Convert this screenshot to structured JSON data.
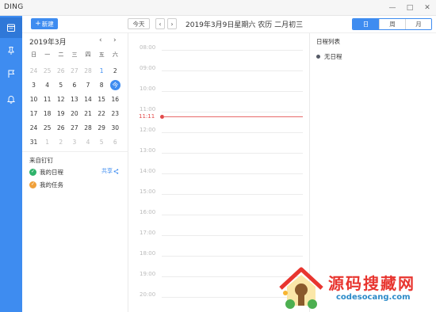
{
  "window": {
    "title": "DING",
    "min": "—",
    "max": "□",
    "close": "✕"
  },
  "rail": {
    "icons": [
      "calendar-icon",
      "pin-icon",
      "flag-icon",
      "bell-icon"
    ],
    "accent": "#3e8cf0"
  },
  "toolbar": {
    "new_label": "新建",
    "new_plus": "+",
    "today_label": "今天",
    "prev": "‹",
    "next": "›",
    "date_title": "2019年3月9日星期六  农历 二月初三",
    "views": [
      "日",
      "周",
      "月"
    ],
    "active_view": "日"
  },
  "mini_calendar": {
    "title": "2019年3月",
    "prev": "‹",
    "next": "›",
    "weekdays": [
      "日",
      "一",
      "二",
      "三",
      "四",
      "五",
      "六"
    ],
    "days": [
      {
        "d": "24",
        "o": true
      },
      {
        "d": "25",
        "o": true
      },
      {
        "d": "26",
        "o": true
      },
      {
        "d": "27",
        "o": true
      },
      {
        "d": "28",
        "o": true
      },
      {
        "d": "1",
        "b": true
      },
      {
        "d": "2"
      },
      {
        "d": "3"
      },
      {
        "d": "4"
      },
      {
        "d": "5"
      },
      {
        "d": "6"
      },
      {
        "d": "7"
      },
      {
        "d": "8"
      },
      {
        "d": "今",
        "sel": true
      },
      {
        "d": "10"
      },
      {
        "d": "11"
      },
      {
        "d": "12"
      },
      {
        "d": "13"
      },
      {
        "d": "14"
      },
      {
        "d": "15"
      },
      {
        "d": "16"
      },
      {
        "d": "17"
      },
      {
        "d": "18"
      },
      {
        "d": "19"
      },
      {
        "d": "20"
      },
      {
        "d": "21"
      },
      {
        "d": "22"
      },
      {
        "d": "23"
      },
      {
        "d": "24"
      },
      {
        "d": "25"
      },
      {
        "d": "26"
      },
      {
        "d": "27"
      },
      {
        "d": "28"
      },
      {
        "d": "29"
      },
      {
        "d": "30"
      },
      {
        "d": "31"
      },
      {
        "d": "1",
        "o": true
      },
      {
        "d": "2",
        "o": true
      },
      {
        "d": "3",
        "o": true
      },
      {
        "d": "4",
        "o": true
      },
      {
        "d": "5",
        "o": true
      },
      {
        "d": "6",
        "o": true
      }
    ]
  },
  "sources": {
    "heading": "来自钉钉",
    "items": [
      {
        "label": "我的日程",
        "color": "#2fb36b",
        "mark": "✓"
      },
      {
        "label": "我的任务",
        "color": "#f0a03a",
        "mark": "✓"
      }
    ],
    "share_label": "共享"
  },
  "timeline": {
    "hours": [
      "08:00",
      "09:00",
      "10:00",
      "11:00",
      "12:00",
      "13:00",
      "14:00",
      "15:00",
      "16:00",
      "17:00",
      "18:00",
      "19:00",
      "20:00"
    ],
    "now_label": "11:11",
    "now_color": "#e24a4a"
  },
  "schedule_list": {
    "title": "日程列表",
    "empty": "无日程"
  },
  "watermark": {
    "text": "源码搜藏网",
    "url": "codesocang.com"
  }
}
